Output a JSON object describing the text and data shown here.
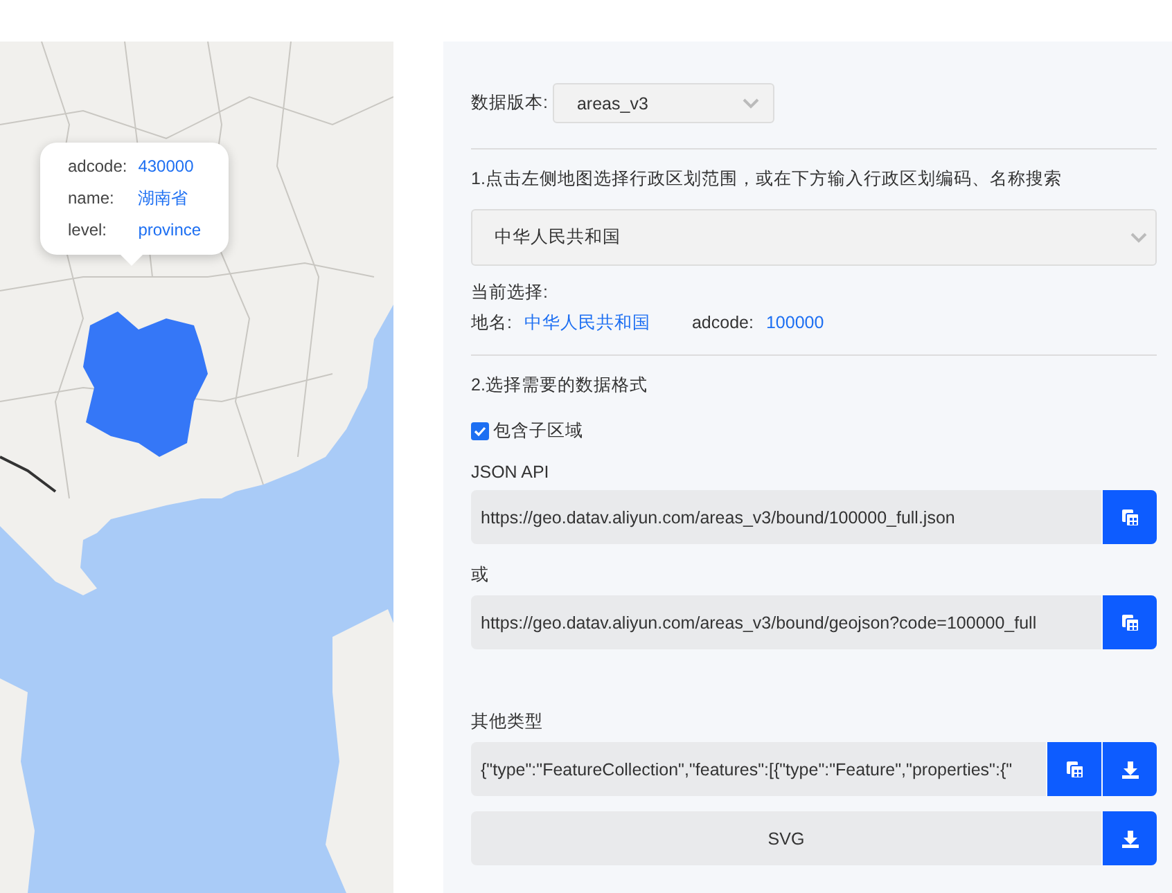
{
  "map": {
    "tooltip": [
      {
        "label": "adcode:",
        "value": "430000"
      },
      {
        "label": "name:",
        "value": "湖南省"
      },
      {
        "label": "level:",
        "value": "province"
      }
    ]
  },
  "panel": {
    "version": {
      "label": "数据版本:",
      "value": "areas_v3"
    },
    "step1": "1.点击左侧地图选择行政区划范围，或在下方输入行政区划编码、名称搜索",
    "region_select": {
      "value": "中华人民共和国"
    },
    "current": {
      "heading": "当前选择:",
      "name_label": "地名:",
      "name_value": "中华人民共和国",
      "code_label": "adcode:",
      "code_value": "100000"
    },
    "step2": "2.选择需要的数据格式",
    "include_subregions": {
      "label": "包含子区域",
      "checked": true
    },
    "exports": [
      {
        "kind": "field",
        "heading": "JSON API",
        "value": "https://geo.datav.aliyun.com/areas_v3/bound/100000_full.json",
        "actions": [
          {
            "kind": "copy"
          }
        ]
      },
      {
        "kind": "field",
        "heading": "或",
        "value": "https://geo.datav.aliyun.com/areas_v3/bound/geojson?code=100000_full",
        "actions": [
          {
            "kind": "copy"
          }
        ]
      },
      {
        "kind": "field",
        "heading": "其他类型",
        "value": "{\"type\":\"FeatureCollection\",\"features\":[{\"type\":\"Feature\",\"properties\":{\"",
        "actions": [
          {
            "kind": "copy"
          },
          {
            "kind": "download"
          }
        ]
      },
      {
        "kind": "button",
        "text": "SVG",
        "actions": [
          {
            "kind": "download"
          }
        ]
      }
    ]
  }
}
